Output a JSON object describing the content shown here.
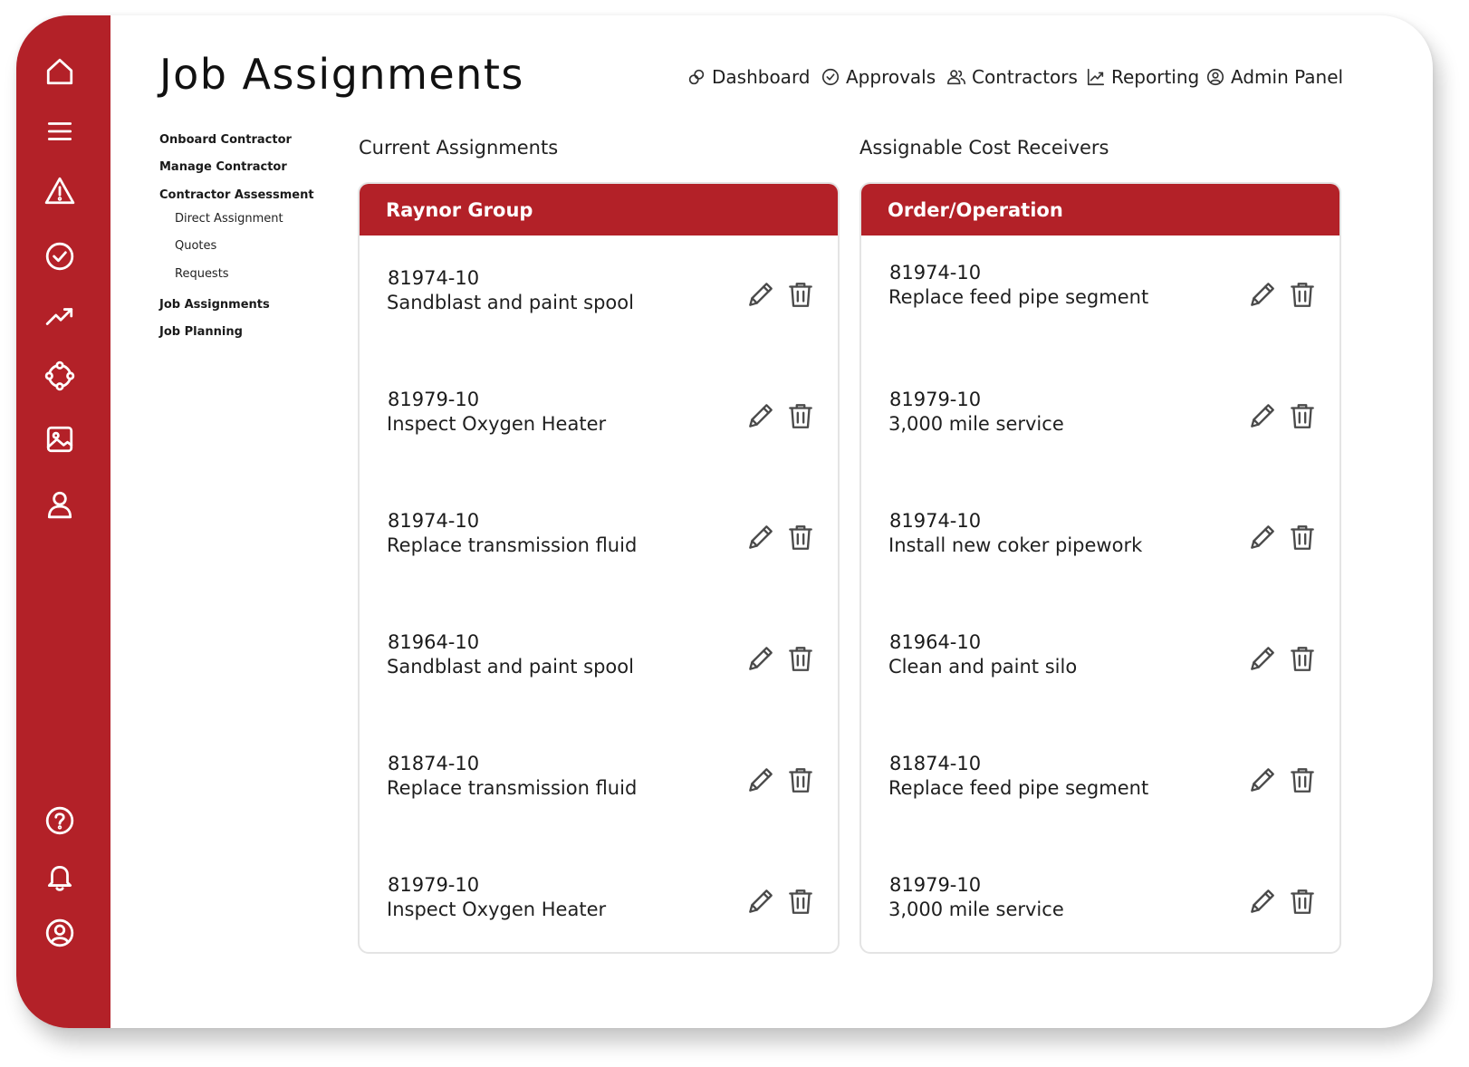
{
  "page_title": "Job Assignments",
  "topnav": [
    {
      "label": "Dashboard",
      "icon": "link-icon"
    },
    {
      "label": "Approvals",
      "icon": "check-circle-icon"
    },
    {
      "label": "Contractors",
      "icon": "users-icon"
    },
    {
      "label": "Reporting",
      "icon": "chart-icon"
    },
    {
      "label": "Admin Panel",
      "icon": "user-circle-icon"
    }
  ],
  "rail_icons": [
    "home-icon",
    "menu-icon",
    "alert-icon",
    "check-circle-icon",
    "trend-icon",
    "network-icon",
    "image-icon",
    "user-icon",
    "help-icon",
    "bell-icon",
    "account-icon"
  ],
  "subnav": [
    {
      "label": "Onboard Contractor"
    },
    {
      "label": "Manage Contractor"
    },
    {
      "label": "Contractor Assessment"
    },
    {
      "label": "Direct Assignment"
    },
    {
      "label": "Quotes"
    },
    {
      "label": "Requests"
    },
    {
      "label": "Job Assignments"
    },
    {
      "label": "Job Planning"
    }
  ],
  "current": {
    "heading": "Current Assignments",
    "panel_title": "Raynor Group",
    "rows": [
      {
        "code": "81974-10",
        "desc": "Sandblast and paint spool"
      },
      {
        "code": "81979-10",
        "desc": "Inspect Oxygen Heater"
      },
      {
        "code": "81974-10",
        "desc": "Replace transmission fluid"
      },
      {
        "code": "81964-10",
        "desc": "Sandblast and paint spool"
      },
      {
        "code": "81874-10",
        "desc": "Replace transmission fluid"
      },
      {
        "code": "81979-10",
        "desc": "Inspect Oxygen Heater"
      }
    ]
  },
  "receivers": {
    "heading": "Assignable Cost Receivers",
    "panel_title": "Order/Operation",
    "rows": [
      {
        "code": "81974-10",
        "desc": "Replace feed pipe segment"
      },
      {
        "code": "81979-10",
        "desc": "3,000 mile service"
      },
      {
        "code": "81974-10",
        "desc": "Install new coker pipework"
      },
      {
        "code": "81964-10",
        "desc": "Clean and paint silo"
      },
      {
        "code": "81874-10",
        "desc": "Replace feed pipe segment"
      },
      {
        "code": "81979-10",
        "desc": "3,000 mile service"
      }
    ]
  },
  "colors": {
    "brand": "#b32128",
    "icon_gray": "#4a4a4a"
  }
}
